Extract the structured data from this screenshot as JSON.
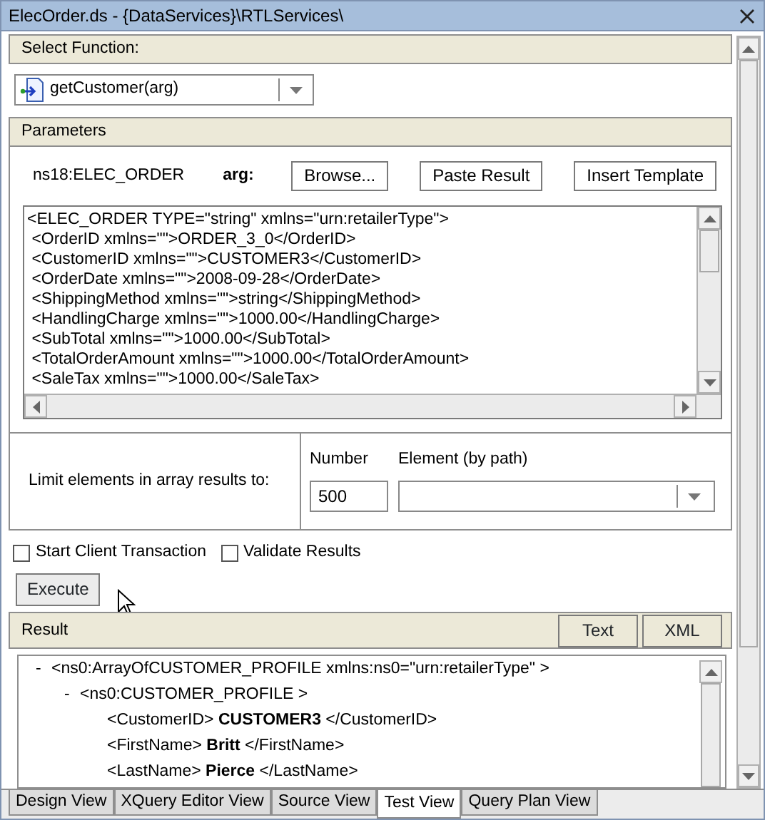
{
  "window": {
    "title": "ElecOrder.ds - {DataServices}\\RTLServices\\"
  },
  "select_function": {
    "header": "Select Function:",
    "value": "getCustomer(arg)"
  },
  "parameters": {
    "header": "Parameters",
    "type": "ns18:ELEC_ORDER",
    "arg_label": "arg:",
    "buttons": [
      "Browse...",
      "Paste Result",
      "Insert Template"
    ],
    "xml_lines": [
      "<ELEC_ORDER TYPE=\"string\" xmlns=\"urn:retailerType\">",
      " <OrderID xmlns=\"\">ORDER_3_0</OrderID>",
      " <CustomerID xmlns=\"\">CUSTOMER3</CustomerID>",
      " <OrderDate xmlns=\"\">2008-09-28</OrderDate>",
      " <ShippingMethod xmlns=\"\">string</ShippingMethod>",
      " <HandlingCharge xmlns=\"\">1000.00</HandlingCharge>",
      " <SubTotal xmlns=\"\">1000.00</SubTotal>",
      " <TotalOrderAmount xmlns=\"\">1000.00</TotalOrderAmount>",
      " <SaleTax xmlns=\"\">1000.00</SaleTax>"
    ]
  },
  "limit": {
    "label": "Limit elements in array results to:",
    "number_label": "Number",
    "number_value": "500",
    "element_label": "Element (by path)"
  },
  "options": [
    {
      "label": "Start Client Transaction",
      "checked": false
    },
    {
      "label": "Validate Results",
      "checked": false
    }
  ],
  "execute_button": "Execute",
  "result": {
    "header": "Result",
    "buttons": [
      "Text",
      "XML"
    ],
    "tree": [
      {
        "marker": "-",
        "text": "<ns0:ArrayOfCUSTOMER_PROFILE xmlns:ns0=\"urn:retailerType\" >",
        "children": [
          {
            "marker": "-",
            "text": "<ns0:CUSTOMER_PROFILE >",
            "children": [
              {
                "text": "<CustomerID> **CUSTOMER3** </CustomerID>"
              },
              {
                "text": "<FirstName> **Britt** </FirstName>"
              },
              {
                "text": "<LastName> **Pierce** </LastName>"
              }
            ]
          }
        ]
      }
    ]
  },
  "tabs": [
    {
      "label": "Design View",
      "selected": false
    },
    {
      "label": "XQuery Editor View",
      "selected": false
    },
    {
      "label": "Source View",
      "selected": false
    },
    {
      "label": "Test View",
      "selected": true
    },
    {
      "label": "Query Plan View",
      "selected": false
    }
  ]
}
